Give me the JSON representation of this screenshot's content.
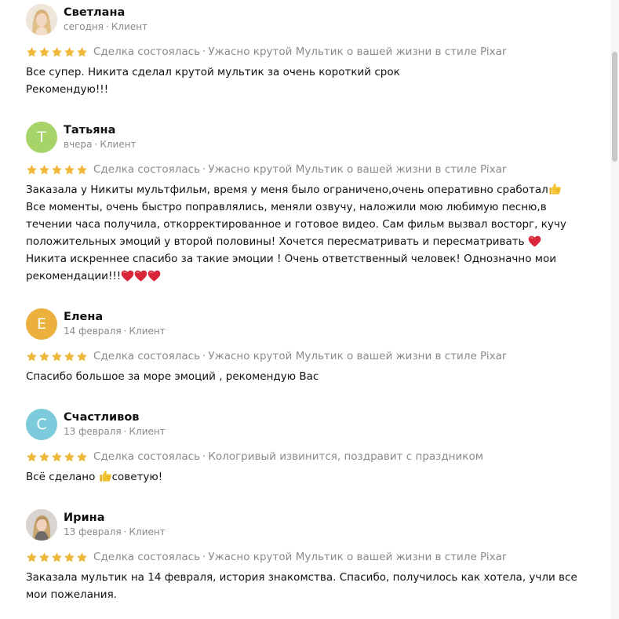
{
  "reviews": [
    {
      "name": "Светлана",
      "date": "сегодня",
      "role": "Клиент",
      "avatar_type": "photo-woman-blonde",
      "stars": 5,
      "deal_status": "Сделка состоялась",
      "service": "Ужасно крутой Мультик о вашей жизни в стиле Pixar",
      "lines": [
        "Все супер. Никита сделал крутой мультик за очень короткий срок",
        "Рекомендую!!!"
      ]
    },
    {
      "name": "Татьяна",
      "date": "вчера",
      "role": "Клиент",
      "avatar_letter": "Т",
      "avatar_color": "#a7d468",
      "stars": 5,
      "deal_status": "Сделка состоялась",
      "service": "Ужасно крутой Мультик о вашей жизни в стиле Pixar",
      "lines": [
        "Заказала у Никиты мультфильм, время у меня было ограничено,очень оперативно сработал",
        "Все моменты, очень быстро поправлялись, меняли озвучу, наложили мою любимую песню,в",
        "течении часа получила, откорректированное и готовое видео. Сам фильм вызвал восторг, кучу",
        "положительных эмоций у второй половины! Хочется пересматривать и пересматривать",
        "Никита искреннее спасибо за такие эмоции ! Очень ответственный человек! Однозначно мои",
        "рекомендации!!!"
      ]
    },
    {
      "name": "Елена",
      "date": "14 февраля",
      "role": "Клиент",
      "avatar_letter": "Е",
      "avatar_color": "#ebb03e",
      "stars": 5,
      "deal_status": "Сделка состоялась",
      "service": "Ужасно крутой Мультик о вашей жизни в стиле Pixar",
      "lines": [
        "Спасибо большое за море эмоций , рекомендую Вас"
      ]
    },
    {
      "name": "Счастливов",
      "date": "13 февраля",
      "role": "Клиент",
      "avatar_letter": "С",
      "avatar_color": "#7ccbdc",
      "stars": 5,
      "deal_status": "Сделка состоялась",
      "service": "Кологривый извинится, поздравит с праздником",
      "line_before_emoji": "Всё сделано ",
      "line_after_emoji": "советую!"
    },
    {
      "name": "Ирина",
      "date": "13 февраля",
      "role": "Клиент",
      "avatar_type": "photo-woman-blonde-2",
      "stars": 5,
      "deal_status": "Сделка состоялась",
      "service": "Ужасно крутой Мультик о вашей жизни в стиле Pixar",
      "lines": [
        "Заказала мультик на 14 февраля, история знакомства. Спасибо, получилось как хотела, учли все",
        "мои пожелания."
      ]
    }
  ],
  "colors": {
    "star": "#f1b73b",
    "muted_text": "#8a8a8a",
    "heart": "#d8263a",
    "thumbs_up": "#f3c431"
  }
}
